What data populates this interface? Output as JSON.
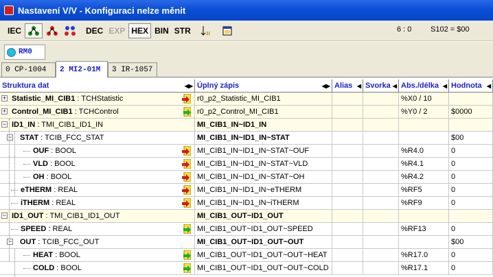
{
  "window": {
    "title": "Nastavení V/V - Konfiguraci nelze měnit"
  },
  "toolbar": {
    "iec": "IEC",
    "dec": "DEC",
    "exp": "EXP",
    "hex": "HEX",
    "bin": "BIN",
    "str": "STR",
    "status1": "6 : 0",
    "status2": "S102 = $00"
  },
  "rm": {
    "label": "RM0"
  },
  "tabs": [
    {
      "label": "0 CP-1004"
    },
    {
      "label": "2 MI2-01M"
    },
    {
      "label": "3 IR-1057"
    }
  ],
  "columns": {
    "struktura": "Struktura dat",
    "zapis": "Úplný zápis",
    "alias": "Alias",
    "svorka": "Svorka",
    "abs": "Abs./délka",
    "hodnota": "Hodnota"
  },
  "rows": [
    {
      "name": "Statistic_MI_CIB1",
      "type": "TCHStatistic",
      "full": "r0_p2_Statistic_MI_CIB1",
      "abs": "%X0 / 10",
      "value": "",
      "icon": "red-arrow-in-icon"
    },
    {
      "name": "Control_MI_CIB1",
      "type": "TCHControl",
      "full": "r0_p2_Control_MI_CIB1",
      "abs": "%Y0 / 2",
      "value": "$0000",
      "icon": "green-arrow-out-icon"
    },
    {
      "name": "ID1_IN",
      "type": "TMI_CIB1_ID1_IN",
      "full": "MI_CIB1_IN~ID1_IN",
      "abs": "",
      "value": "",
      "icon": ""
    },
    {
      "name": "STAT",
      "type": "TCIB_FCC_STAT",
      "full": "MI_CIB1_IN~ID1_IN~STAT",
      "abs": "",
      "value": "$00",
      "icon": ""
    },
    {
      "name": "OUF",
      "type": "BOOL",
      "full": "MI_CIB1_IN~ID1_IN~STAT~OUF",
      "abs": "%R4.0",
      "value": "0",
      "icon": "red-arrow-in-icon"
    },
    {
      "name": "VLD",
      "type": "BOOL",
      "full": "MI_CIB1_IN~ID1_IN~STAT~VLD",
      "abs": "%R4.1",
      "value": "0",
      "icon": "red-arrow-in-icon"
    },
    {
      "name": "OH",
      "type": "BOOL",
      "full": "MI_CIB1_IN~ID1_IN~STAT~OH",
      "abs": "%R4.2",
      "value": "0",
      "icon": "red-arrow-in-icon"
    },
    {
      "name": "eTHERM",
      "type": "REAL",
      "full": "MI_CIB1_IN~ID1_IN~eTHERM",
      "abs": "%RF5",
      "value": "0",
      "icon": "red-arrow-in-icon"
    },
    {
      "name": "iTHERM",
      "type": "REAL",
      "full": "MI_CIB1_IN~ID1_IN~iTHERM",
      "abs": "%RF9",
      "value": "0",
      "icon": "red-arrow-in-icon"
    },
    {
      "name": "ID1_OUT",
      "type": "TMI_CIB1_ID1_OUT",
      "full": "MI_CIB1_OUT~ID1_OUT",
      "abs": "",
      "value": "",
      "icon": ""
    },
    {
      "name": "SPEED",
      "type": "REAL",
      "full": "MI_CIB1_OUT~ID1_OUT~SPEED",
      "abs": "%RF13",
      "value": "0",
      "icon": "green-arrow-out-icon"
    },
    {
      "name": "OUT",
      "type": "TCIB_FCC_OUT",
      "full": "MI_CIB1_OUT~ID1_OUT~OUT",
      "abs": "",
      "value": "$00",
      "icon": ""
    },
    {
      "name": "HEAT",
      "type": "BOOL",
      "full": "MI_CIB1_OUT~ID1_OUT~OUT~HEAT",
      "abs": "%R17.0",
      "value": "0",
      "icon": "green-arrow-out-icon"
    },
    {
      "name": "COLD",
      "type": "BOOL",
      "full": "MI_CIB1_OUT~ID1_OUT~OUT~COLD",
      "abs": "%R17.1",
      "value": "0",
      "icon": "green-arrow-out-icon"
    }
  ]
}
